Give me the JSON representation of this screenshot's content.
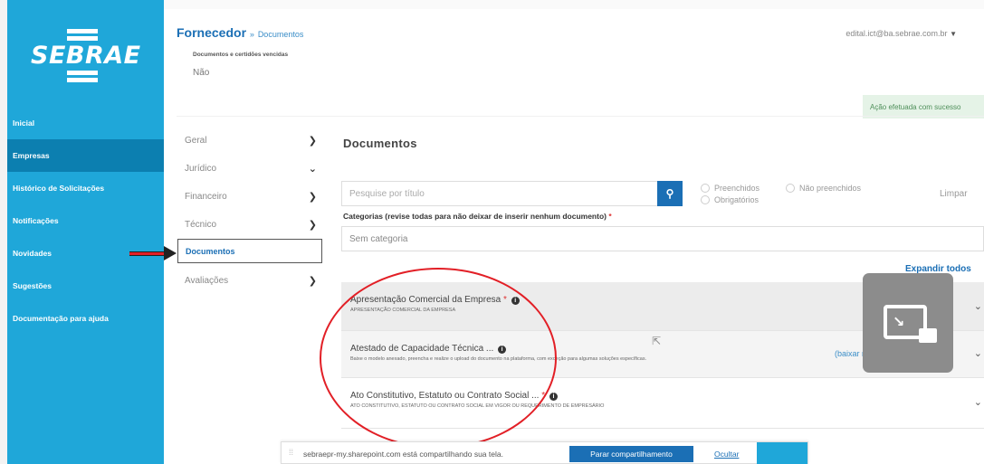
{
  "brand": {
    "logo_text": "SEBRAE",
    "color": "#1fa7d9"
  },
  "header": {
    "title": "Fornecedor",
    "sep": "»",
    "section": "Documentos",
    "user_email": "edital.ict@ba.sebrae.com.br",
    "user_caret": "▼"
  },
  "sidebar": {
    "items": [
      {
        "label": "Inicial",
        "icon": "home-icon"
      },
      {
        "label": "Empresas",
        "icon": "building-icon",
        "active": true
      },
      {
        "label": "Histórico de Solicitações",
        "icon": "history-icon"
      },
      {
        "label": "Notificações",
        "icon": "bell-icon"
      },
      {
        "label": "Novidades",
        "icon": "megaphone-icon"
      },
      {
        "label": "Sugestões",
        "icon": "lightbulb-icon"
      },
      {
        "label": "Documentação para ajuda",
        "icon": "document-icon"
      }
    ]
  },
  "top_info": {
    "label": "Documentos e certidões vencidas",
    "value": "Não"
  },
  "toast": "Ação efetuada com sucesso",
  "tabs": [
    {
      "label": "Geral",
      "chev": "❯"
    },
    {
      "label": "Jurídico",
      "chev": "⌄"
    },
    {
      "label": "Financeiro",
      "chev": "❯"
    },
    {
      "label": "Técnico",
      "chev": "❯"
    },
    {
      "label": "Documentos",
      "chev": ""
    },
    {
      "label": "Avaliações",
      "chev": "❯"
    }
  ],
  "main": {
    "title": "Documentos",
    "search_placeholder": "Pesquise por título",
    "search_button": "⚲",
    "filters": [
      "Preenchidos",
      "Não preenchidos",
      "Obrigatórios"
    ],
    "clear": "Limpar",
    "categories_label": "Categorias (revise todas para não deixar de inserir nenhum documento)",
    "categories_req": "*",
    "category_value": "Sem categoria",
    "expand_all": "Expandir todos"
  },
  "documents": [
    {
      "title": "Apresentação Comercial da Empresa",
      "req": "*",
      "desc": "APRESENTAÇÃO COMERCIAL DA EMPRESA"
    },
    {
      "title": "Atestado de Capacidade Técnica ...",
      "req": "",
      "desc": "Baixe o modelo anexado, preencha e realize o upload do documento na plataforma, com exceção para algumas soluções específicas.",
      "link": "(baixar modelo)"
    },
    {
      "title": "Ato Constitutivo, Estatuto ou Contrato Social ...",
      "req": "*",
      "desc": "ATO CONSTITUTIVO, ESTATUTO OU CONTRATO SOCIAL EM VIGOR OU REQUERIMENTO DE EMPRESÁRIO"
    }
  ],
  "share_bar": {
    "grip": "⁞⁞",
    "message": "sebraepr-my.sharepoint.com está compartilhando sua tela.",
    "stop": "Parar compartilhamento",
    "hide": "Ocultar"
  },
  "annotation_color": "#e21f26"
}
